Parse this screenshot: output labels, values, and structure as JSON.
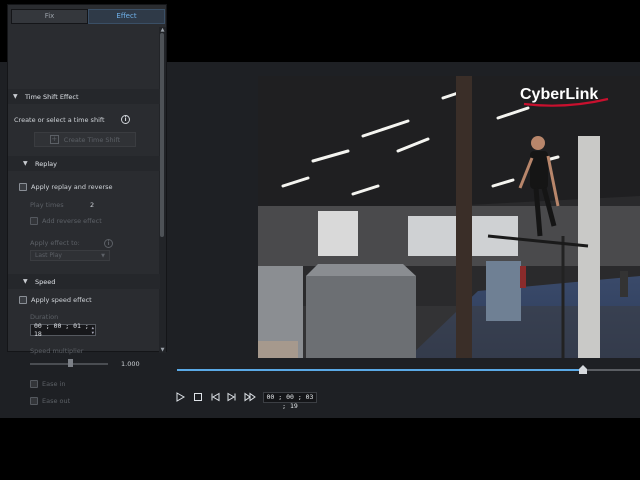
{
  "tabs": [
    {
      "label": "Fix"
    },
    {
      "label": "Effect"
    }
  ],
  "time_shift": {
    "title": "Time Shift Effect",
    "create_label": "Create or select a time shift",
    "create_button": "Create Time Shift"
  },
  "replay": {
    "title": "Replay",
    "apply_label": "Apply replay and reverse",
    "play_times_label": "Play times",
    "play_times_value": "2",
    "reverse_label": "Add reverse effect",
    "apply_to_label": "Apply effect to:",
    "apply_to_value": "Last Play"
  },
  "speed": {
    "title": "Speed",
    "apply_label": "Apply speed effect",
    "duration_label": "Duration",
    "duration_value": "00 ; 00 ; 01 ; 18",
    "multiplier_label": "Speed multiplier",
    "multiplier_value": "1.000",
    "ease_in_label": "Ease in",
    "ease_out_label": "Ease out"
  },
  "player": {
    "timecode": "00 ; 00 ; 03 ; 19",
    "progress": 0.876
  },
  "logo_text": "CyberLink",
  "icons": [
    "play-icon",
    "stop-icon",
    "prev-frame-icon",
    "next-frame-icon",
    "fast-forward-icon",
    "info-icon",
    "chevron-down-icon"
  ],
  "colors": {
    "accent": "#5aa9e6",
    "logo_red": "#c8102e"
  }
}
